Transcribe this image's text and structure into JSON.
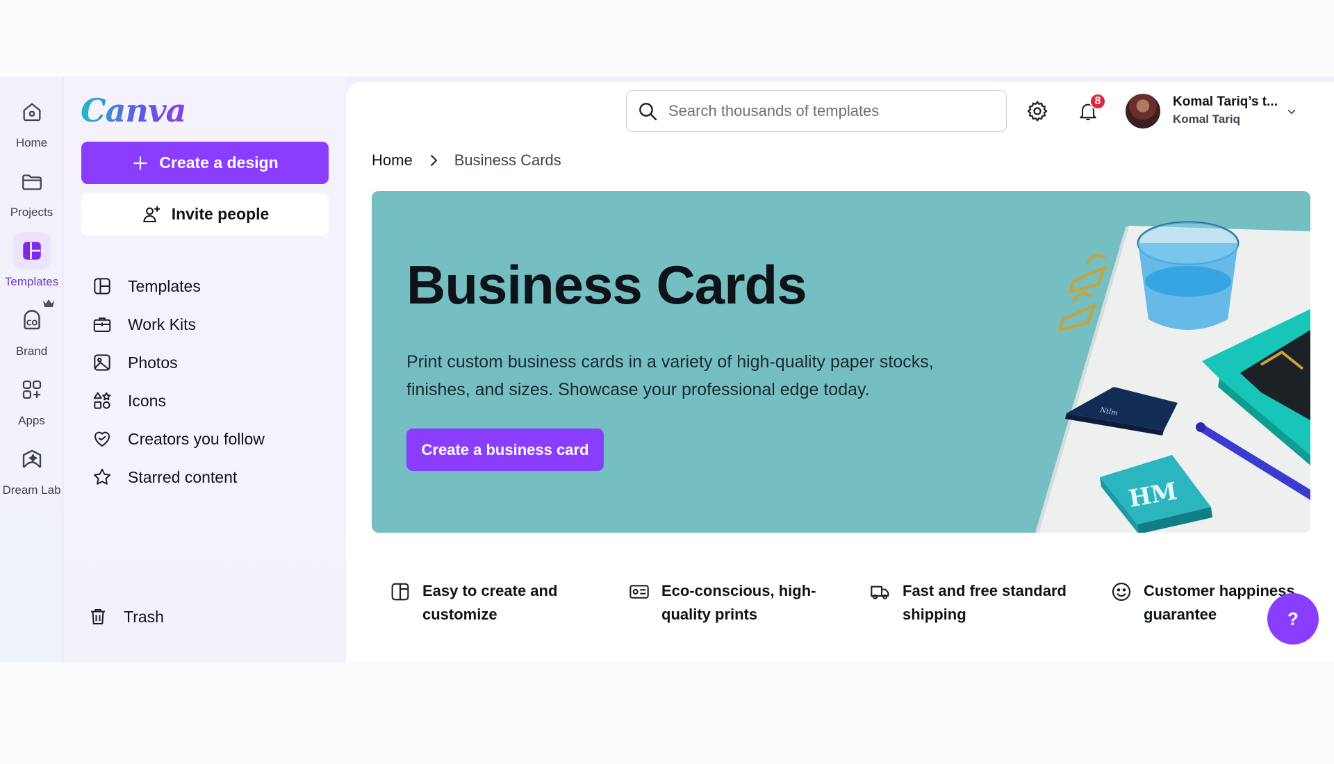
{
  "rail": {
    "items": [
      {
        "label": "Home",
        "icon": "home-icon"
      },
      {
        "label": "Projects",
        "icon": "folder-icon"
      },
      {
        "label": "Templates",
        "icon": "templates-icon",
        "active": true
      },
      {
        "label": "Brand",
        "icon": "brand-icon"
      },
      {
        "label": "Apps",
        "icon": "apps-icon"
      },
      {
        "label": "Dream Lab",
        "icon": "dream-lab-icon"
      }
    ]
  },
  "sidebar": {
    "logo": "Canva",
    "create_label": "Create a design",
    "invite_label": "Invite people",
    "items": [
      {
        "label": "Templates",
        "icon": "templates-icon"
      },
      {
        "label": "Work Kits",
        "icon": "briefcase-icon"
      },
      {
        "label": "Photos",
        "icon": "photo-icon"
      },
      {
        "label": "Icons",
        "icon": "shapes-icon"
      },
      {
        "label": "Creators you follow",
        "icon": "heart-icon"
      },
      {
        "label": "Starred content",
        "icon": "star-icon"
      }
    ],
    "trash_label": "Trash"
  },
  "header": {
    "search_placeholder": "Search thousands of templates",
    "notification_count": "8",
    "account_name": "Komal Tariq’s t...",
    "account_user": "Komal Tariq"
  },
  "breadcrumb": {
    "home": "Home",
    "current": "Business Cards"
  },
  "hero": {
    "title": "Business Cards",
    "description": "Print custom business cards in a variety of high-quality paper stocks, finishes, and sizes. Showcase your professional edge today.",
    "cta": "Create a business card",
    "background_color": "#75bec2"
  },
  "features": [
    {
      "text": "Easy to create and customize",
      "icon": "template-icon"
    },
    {
      "text": "Eco-conscious, high-quality prints",
      "icon": "print-icon"
    },
    {
      "text": "Fast and free standard shipping",
      "icon": "truck-icon"
    },
    {
      "text": "Customer happiness guarantee",
      "icon": "smiley-icon"
    }
  ],
  "help_label": "?",
  "colors": {
    "accent": "#8b3dff",
    "badge": "#e0243b"
  }
}
